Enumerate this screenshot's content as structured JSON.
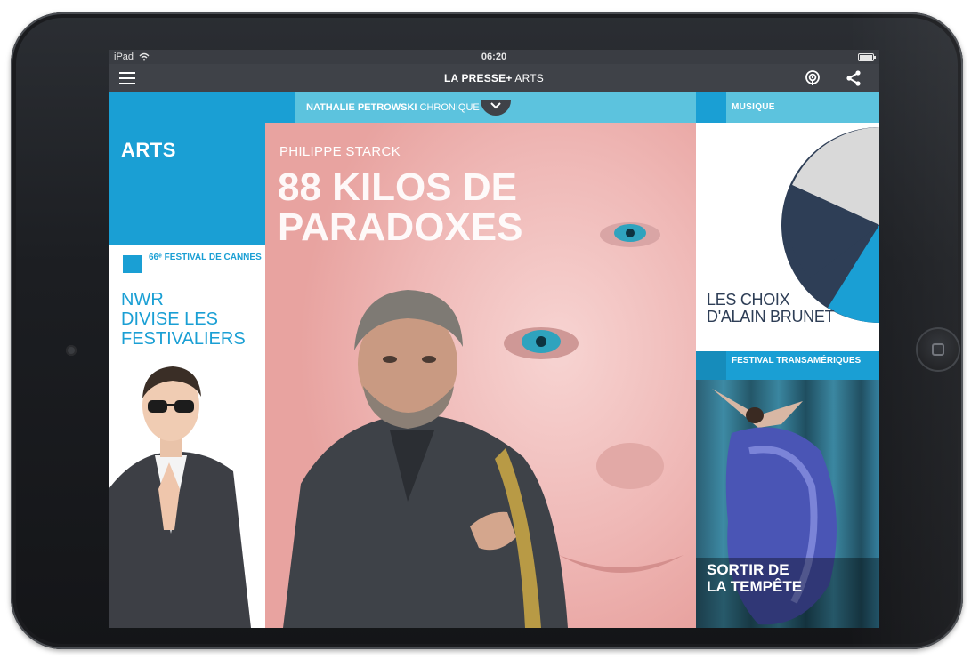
{
  "statusbar": {
    "device": "iPad",
    "time": "06:20"
  },
  "navbar": {
    "brand": "LA PRESSE+",
    "section": "ARTS"
  },
  "left": {
    "section_title": "ARTS",
    "festival_label": "66ᵉ FESTIVAL DE CANNES",
    "headline": "NWR\nDIVISE LES\nFESTIVALIERS"
  },
  "center": {
    "columnist": "NATHALIE PETROWSKI",
    "column_type": "CHRONIQUE",
    "kicker": "PHILIPPE STARCK",
    "headline": "88 KILOS DE\nPARADOXES"
  },
  "right": {
    "music_label": "MUSIQUE",
    "music_headline": "LES CHOIX\nD'ALAIN BRUNET",
    "festival_label": "FESTIVAL TRANSAMÉRIQUES",
    "festival_headline": "SORTIR DE\nLA TEMPÊTE"
  },
  "colors": {
    "accent": "#1a9fd4",
    "accent_light": "#5cc3de",
    "navbar": "#3f4248",
    "pie_navy": "#2e3e56",
    "pie_salmon": "#f2947d"
  }
}
